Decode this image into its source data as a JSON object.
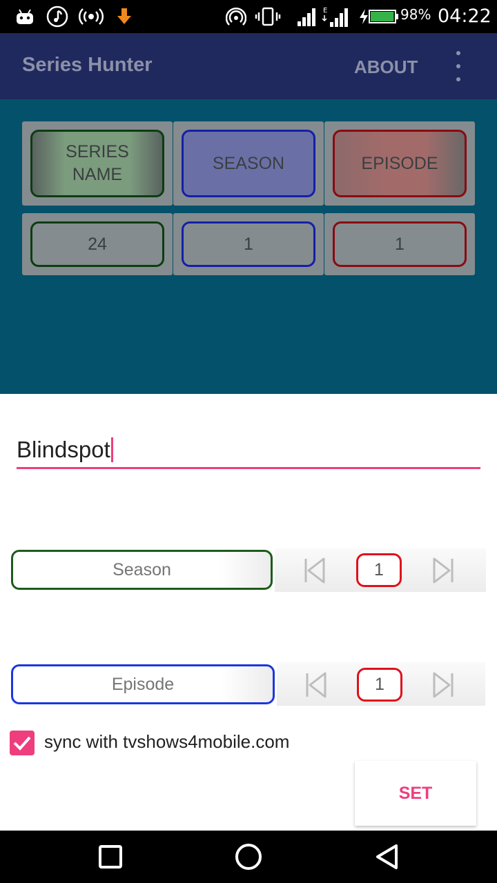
{
  "status_bar": {
    "icons": [
      "android-icon",
      "music-icon",
      "broadcast-icon",
      "download-icon",
      "hotspot-icon",
      "vibrate-icon",
      "signal-icon",
      "signal-e-icon",
      "charging-icon",
      "battery-icon"
    ],
    "network_type": "E",
    "battery_percent": "98%",
    "battery_level": 0.98,
    "time": "04:22"
  },
  "app_bar": {
    "title": "Series Hunter",
    "about_label": "ABOUT",
    "menu_icon": "overflow-menu-icon"
  },
  "table": {
    "headers": [
      "SERIES\nNAME",
      "SEASON",
      "EPISODE"
    ],
    "row": [
      "24",
      "1",
      "1"
    ]
  },
  "dialog": {
    "name_value": "Blindspot",
    "season": {
      "label": "Season",
      "value": "1"
    },
    "episode": {
      "label": "Episode",
      "value": "1"
    },
    "prev_icon": "skip-previous-icon",
    "next_icon": "skip-next-icon",
    "sync_checked": true,
    "sync_label": "sync with tvshows4mobile.com",
    "set_label": "SET"
  },
  "nav_bar": {
    "icons": [
      "recents-icon",
      "home-icon",
      "back-icon"
    ]
  },
  "colors": {
    "accent": "#ee3e7e",
    "green": "#1c5b1a",
    "blue": "#1c36e0",
    "red": "#e0101a",
    "appbar_dim": "#1f295e",
    "content_dim": "#03516a"
  }
}
